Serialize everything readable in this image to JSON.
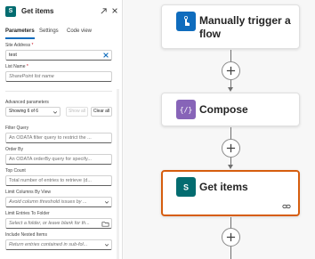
{
  "panel": {
    "title": "Get items",
    "app_badge_text": "S",
    "tabs": [
      {
        "label": "Parameters",
        "active": true
      },
      {
        "label": "Settings",
        "active": false
      },
      {
        "label": "Code view",
        "active": false
      }
    ],
    "fields": {
      "site_address": {
        "label": "Site Address",
        "required_mark": "*",
        "value": "test"
      },
      "list_name": {
        "label": "List Name",
        "required_mark": "*",
        "placeholder": "SharePoint list name"
      },
      "advanced": {
        "label": "Advanced parameters",
        "selected": "Showing 6 of 6",
        "show_all_label": "Show all",
        "clear_all_label": "Clear all"
      },
      "filter_query": {
        "label": "Filter Query",
        "placeholder": "An ODATA filter query to restrict the ..."
      },
      "order_by": {
        "label": "Order By",
        "placeholder": "An ODATA orderBy query for specify..."
      },
      "top_count": {
        "label": "Top Count",
        "placeholder": "Total number of entries to retrieve (d..."
      },
      "limit_columns": {
        "label": "Limit Columns By View",
        "placeholder": "Avoid column threshold issues by ..."
      },
      "limit_entries": {
        "label": "Limit Entries To Folder",
        "placeholder": "Select a folder, or leave blank for th..."
      },
      "nested_items": {
        "label": "Include Nested Items",
        "placeholder": "Return entries contained in sub-fol..."
      }
    }
  },
  "canvas": {
    "steps": [
      {
        "title": "Manually trigger a flow",
        "icon": "hand-tap-icon",
        "icon_color": "#0f6cbd"
      },
      {
        "title": "Compose",
        "icon": "curly-braces-icon",
        "icon_color": "#8764b8"
      },
      {
        "title": "Get items",
        "icon": "sharepoint-icon",
        "icon_color": "#036c70",
        "selected": true
      }
    ],
    "selected_border_color": "#d65d0e"
  }
}
